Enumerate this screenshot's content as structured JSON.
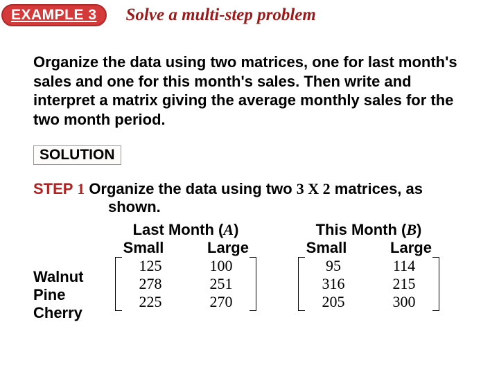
{
  "header": {
    "badge": "EXAMPLE 3",
    "title": "Solve a multi-step problem"
  },
  "problem": "Organize the data using two matrices, one for last month's sales and one for this month's sales. Then write and interpret a matrix giving the average monthly sales for the two month period.",
  "solution_label": "SOLUTION",
  "step": {
    "label": "STEP",
    "number": "1",
    "text_a": "Organize the data using two ",
    "dims": "3 X 2",
    "text_b": " matrices, as",
    "text_c": "shown."
  },
  "row_labels": [
    "Walnut",
    "Pine",
    "Cherry"
  ],
  "matrix_a": {
    "title_prefix": "Last Month (",
    "letter": "A",
    "title_suffix": ")",
    "cols": [
      "Small",
      "Large"
    ],
    "data": [
      [
        "125",
        "100"
      ],
      [
        "278",
        "251"
      ],
      [
        "225",
        "270"
      ]
    ]
  },
  "matrix_b": {
    "title_prefix": "This Month (",
    "letter": "B",
    "title_suffix": ")",
    "cols": [
      "Small",
      "Large"
    ],
    "data": [
      [
        "95",
        "114"
      ],
      [
        "316",
        "215"
      ],
      [
        "205",
        "300"
      ]
    ]
  }
}
